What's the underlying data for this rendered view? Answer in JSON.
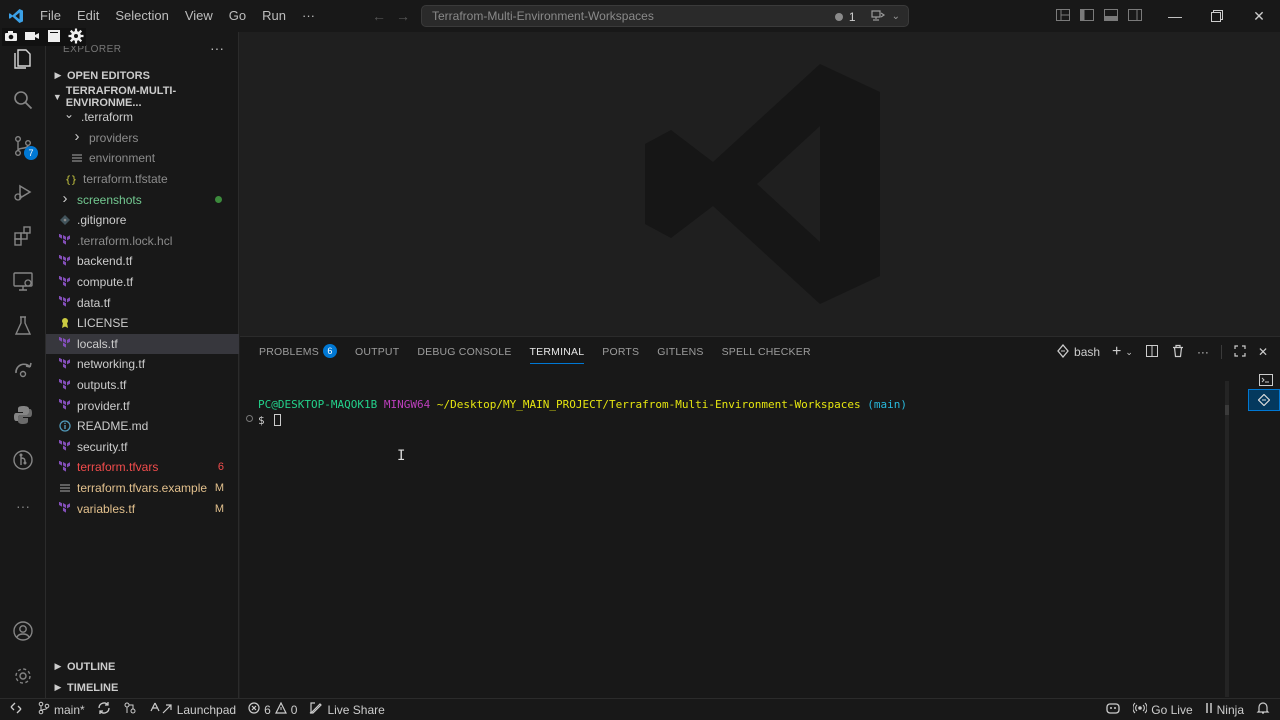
{
  "titlebar": {
    "menu": [
      "File",
      "Edit",
      "Selection",
      "View",
      "Go",
      "Run",
      "···"
    ],
    "search_text": "Terrafrom-Multi-Environment-Workspaces",
    "notification_count": "1"
  },
  "activity_bar": {
    "source_control_badge": "7"
  },
  "sidebar": {
    "title": "EXPLORER",
    "open_editors": "OPEN EDITORS",
    "project": "TERRAFROM-MULTI-ENVIRONME...",
    "items": [
      {
        "label": ".terraform",
        "badge": "",
        "color": "#cccccc"
      },
      {
        "label": "providers",
        "badge": "",
        "color": "#8c8c8c"
      },
      {
        "label": "environment",
        "badge": "",
        "color": "#8c8c8c"
      },
      {
        "label": "terraform.tfstate",
        "badge": "",
        "color": "#8c8c8c"
      },
      {
        "label": "screenshots",
        "badge": "",
        "color": "#73c991"
      },
      {
        "label": ".gitignore",
        "badge": "",
        "color": "#cccccc"
      },
      {
        "label": ".terraform.lock.hcl",
        "badge": "",
        "color": "#8c8c8c"
      },
      {
        "label": "backend.tf",
        "badge": "",
        "color": "#cccccc"
      },
      {
        "label": "compute.tf",
        "badge": "",
        "color": "#cccccc"
      },
      {
        "label": "data.tf",
        "badge": "",
        "color": "#cccccc"
      },
      {
        "label": "LICENSE",
        "badge": "",
        "color": "#cccccc"
      },
      {
        "label": "locals.tf",
        "badge": "",
        "color": "#cccccc"
      },
      {
        "label": "networking.tf",
        "badge": "",
        "color": "#cccccc"
      },
      {
        "label": "outputs.tf",
        "badge": "",
        "color": "#cccccc"
      },
      {
        "label": "provider.tf",
        "badge": "",
        "color": "#cccccc"
      },
      {
        "label": "README.md",
        "badge": "",
        "color": "#cccccc"
      },
      {
        "label": "security.tf",
        "badge": "",
        "color": "#cccccc"
      },
      {
        "label": "terraform.tfvars",
        "badge": "6",
        "color": "#f14c4c"
      },
      {
        "label": "terraform.tfvars.example",
        "badge": "M",
        "color": "#e2c08d"
      },
      {
        "label": "variables.tf",
        "badge": "M",
        "color": "#e2c08d"
      }
    ],
    "outline": "OUTLINE",
    "timeline": "TIMELINE"
  },
  "panel": {
    "tabs": {
      "problems": "PROBLEMS",
      "problems_count": "6",
      "output": "OUTPUT",
      "debug_console": "DEBUG CONSOLE",
      "terminal": "TERMINAL",
      "ports": "PORTS",
      "gitlens": "GITLENS",
      "spell_checker": "SPELL CHECKER"
    },
    "shell": "bash",
    "terminal": {
      "user_host": "PC@DESKTOP-MAQOK1B",
      "env": "MINGW64",
      "path": "~/Desktop/MY_MAIN_PROJECT/Terrafrom-Multi-Environment-Workspaces",
      "branch": "(main)",
      "prompt": "$"
    }
  },
  "statusbar": {
    "branch": "main*",
    "launchpad": "Launchpad",
    "errors": "6",
    "warnings": "0",
    "live_share": "Live Share",
    "go_live": "Go Live",
    "ninja": "Ninja"
  },
  "colors": {
    "accent": "#0078d4",
    "terraform_purple": "#844fba",
    "git_modified": "#e2c08d",
    "git_error": "#f14c4c",
    "git_untracked": "#73c991"
  }
}
